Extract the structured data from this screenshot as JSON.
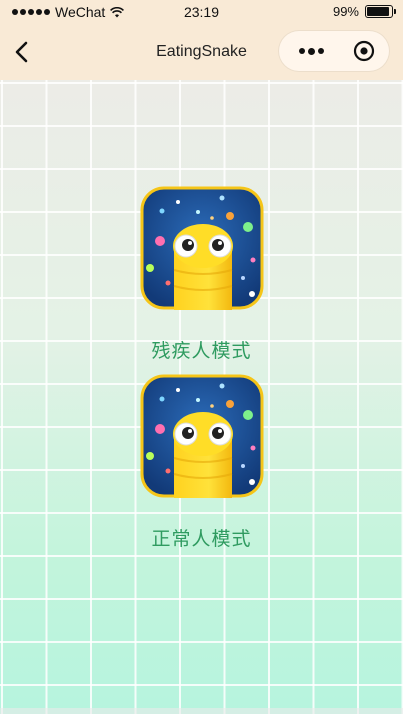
{
  "status_bar": {
    "carrier": "WeChat",
    "time": "23:19",
    "battery": "99%"
  },
  "nav": {
    "title": "EatingSnake"
  },
  "modes": [
    {
      "label": "残疾人模式",
      "icon": "snake-game-icon"
    },
    {
      "label": "正常人模式",
      "icon": "snake-game-icon"
    }
  ],
  "colors": {
    "nav_bg": "#f9ead6",
    "label_green": "#2f9b60",
    "icon_border": "#f5c518",
    "icon_bg": "#1d4a8c"
  }
}
